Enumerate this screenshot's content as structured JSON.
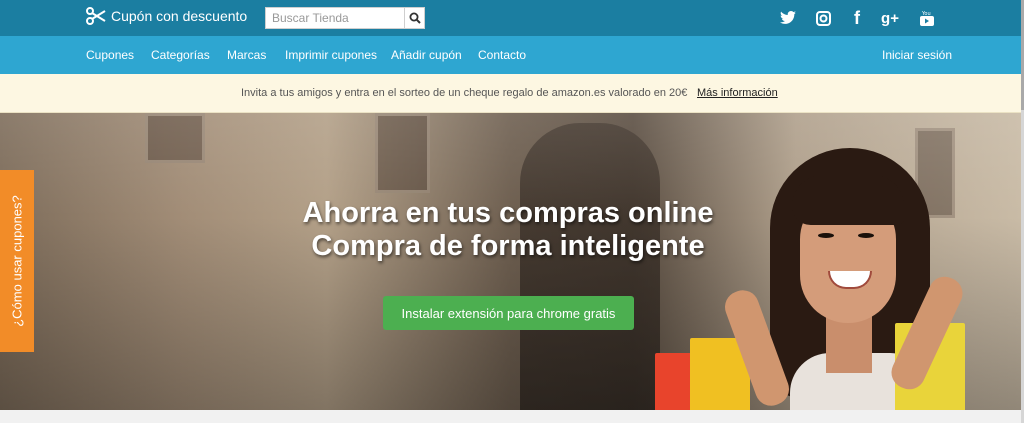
{
  "header": {
    "brand_name": "Cupón con descuento",
    "search_placeholder": "Buscar Tienda",
    "social": [
      {
        "name": "twitter-icon",
        "glyph": "🐦"
      },
      {
        "name": "instagram-icon",
        "glyph": "◙"
      },
      {
        "name": "facebook-icon",
        "glyph": "f"
      },
      {
        "name": "google-plus-icon",
        "glyph": "g+"
      },
      {
        "name": "youtube-icon",
        "glyph": "▶"
      }
    ]
  },
  "nav": {
    "items": [
      "Cupones",
      "Categorías",
      "Marcas",
      "Imprimir cupones",
      "Añadir cupón",
      "Contacto"
    ],
    "login": "Iniciar sesión"
  },
  "notice": {
    "text": "Invita a tus amigos y entra en el sorteo de un cheque regalo de amazon.es valorado en 20€",
    "link": "Más información"
  },
  "hero": {
    "title_line1": "Ahorra en tus compras online",
    "title_line2": "Compra de forma inteligente",
    "cta": "Instalar extensión para chrome gratis"
  },
  "side_tab": {
    "label": "¿Cómo usar cupones?"
  },
  "colors": {
    "topbar": "#1b7ea1",
    "navbar": "#2ea6d1",
    "notice_bg": "#fdf7e2",
    "cta": "#4caf50",
    "side_tab": "#f28c28"
  }
}
